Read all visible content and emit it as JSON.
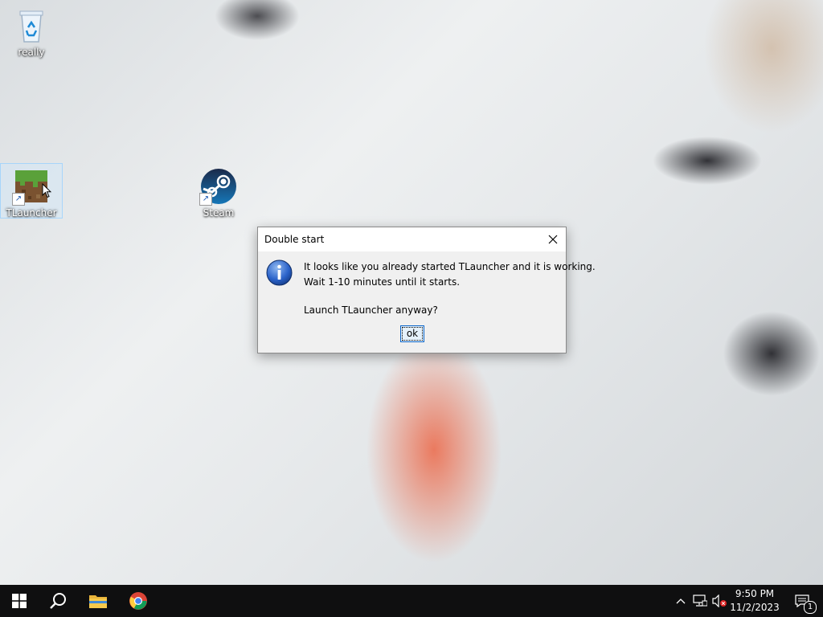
{
  "desktop": {
    "icons": [
      {
        "label": "really",
        "icon": "recycle-bin-icon"
      },
      {
        "label": "TLauncher",
        "icon": "minecraft-grass-block-icon"
      },
      {
        "label": "Steam",
        "icon": "steam-icon"
      }
    ]
  },
  "dialog": {
    "title": "Double start",
    "line1": "It looks like you already started TLauncher and it is working.",
    "line2": "Wait 1-10 minutes until it starts.",
    "line3": "Launch TLauncher anyway?",
    "ok_label": "ok",
    "icon": "info-icon"
  },
  "taskbar": {
    "apps": [
      "start-icon",
      "search-icon",
      "file-explorer-icon",
      "chrome-icon"
    ],
    "tray": [
      "chevron-up-icon",
      "network-icon",
      "volume-muted-icon"
    ],
    "time": "9:50 PM",
    "date": "11/2/2023",
    "notification_count": "1"
  },
  "colors": {
    "taskbar": "#0f0f10",
    "dialog_bg": "#f0f0f0",
    "ok_border": "#0a64c8",
    "info_blue": "#2a62c9"
  }
}
